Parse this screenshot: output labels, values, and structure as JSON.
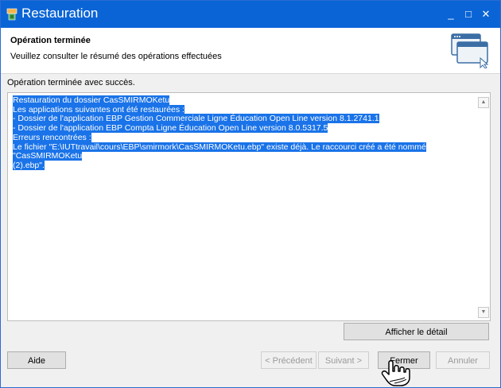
{
  "window": {
    "title": "Restauration"
  },
  "header": {
    "title": "Opération terminée",
    "subtitle": "Veuillez consulter le résumé des opérations effectuées"
  },
  "status": "Opération terminée avec succès.",
  "summary": {
    "lines": [
      "Restauration du dossier CasSMIRMOKetu",
      "Les applications suivantes ont été restaurées :",
      "- Dossier de l'application EBP Gestion Commerciale Ligne Éducation Open Line version 8.1.2741.1",
      "- Dossier de l'application EBP Compta Ligne Éducation Open Line version 8.0.5317.5",
      "Erreurs rencontrées :",
      "Le fichier \"E:\\IUTtravail\\cours\\EBP\\smirmork\\CasSMIRMOKetu.ebp\" existe déjà. Le raccourci créé a été nommé \"CasSMIRMOKetu",
      "(2).ebp\"."
    ]
  },
  "buttons": {
    "details": "Afficher le détail",
    "help": "Aide",
    "previous": "< Précédent",
    "next": "Suivant >",
    "close": "Fermer",
    "cancel": "Annuler"
  },
  "titlebar": {
    "minimize": "_",
    "maximize": "□",
    "close": "✕"
  },
  "colors": {
    "titlebar": "#0a64d6",
    "selection": "#1a73e8"
  }
}
